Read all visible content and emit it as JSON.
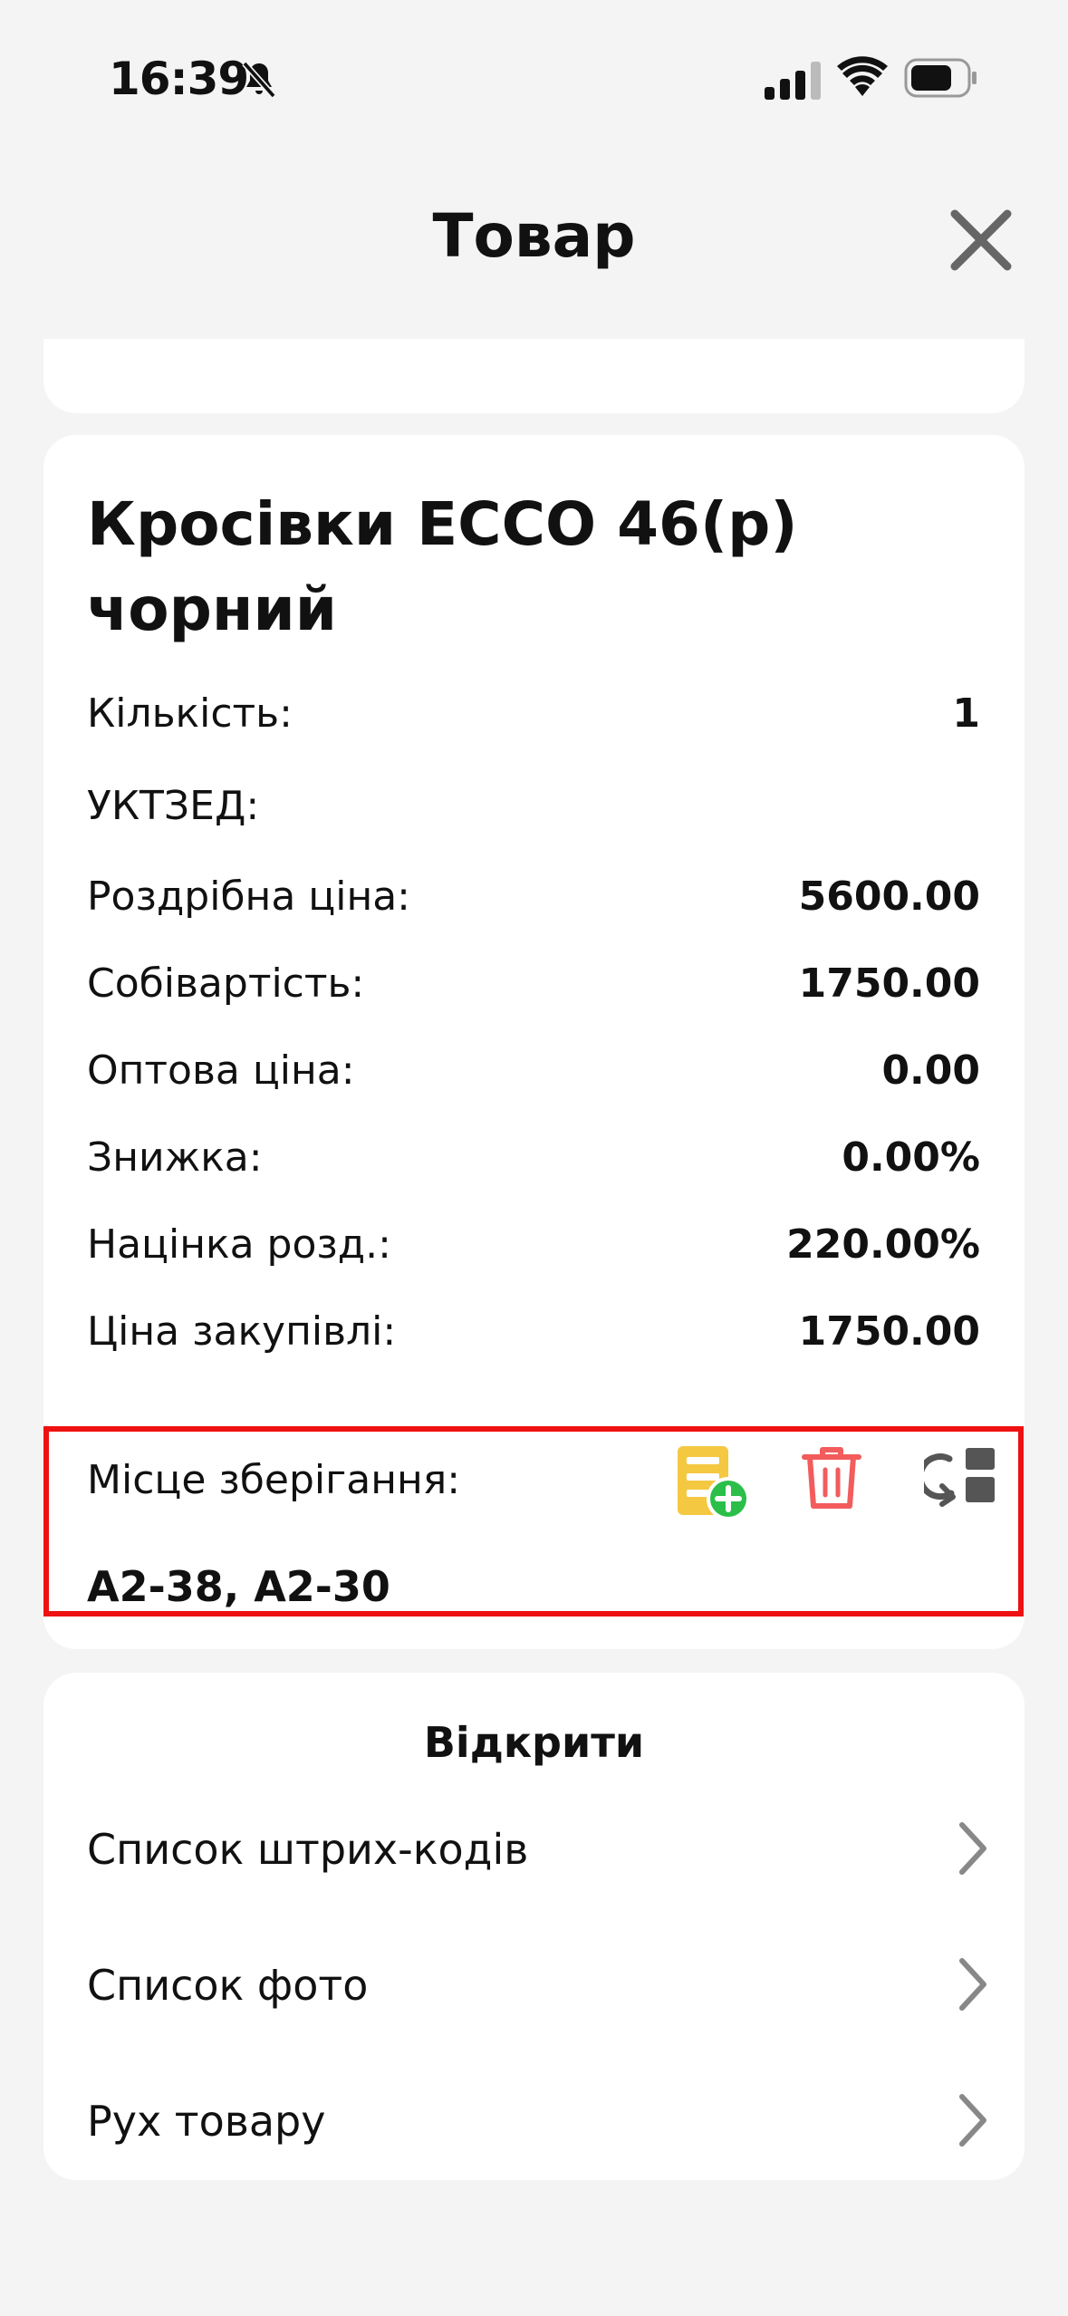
{
  "status_bar": {
    "time": "16:39"
  },
  "nav": {
    "title": "Товар"
  },
  "product": {
    "title": "Кросівки ECCO 46(р) чорний",
    "fields": [
      {
        "label": "Кількість:",
        "value": "1"
      },
      {
        "label": "УКТЗЕД:",
        "value": ""
      },
      {
        "label": "Роздрібна ціна:",
        "value": "5600.00"
      },
      {
        "label": "Собівартість:",
        "value": "1750.00"
      },
      {
        "label": "Оптова ціна:",
        "value": "0.00"
      },
      {
        "label": "Знижка:",
        "value": "0.00%"
      },
      {
        "label": "Націнка розд.:",
        "value": "220.00%"
      },
      {
        "label": "Ціна закупівлі:",
        "value": "1750.00"
      }
    ]
  },
  "storage": {
    "label": "Місце зберігання:",
    "value": "A2-38, A2-30",
    "icons": [
      "storage-add-icon",
      "trash-icon",
      "move-storage-icon"
    ]
  },
  "open_section": {
    "title": "Відкрити",
    "items": [
      {
        "label": "Список штрих-кодів"
      },
      {
        "label": "Список фото"
      },
      {
        "label": "Рух товару"
      }
    ]
  },
  "colors": {
    "highlight_border": "#ee1111",
    "add_icon_yellow": "#f5c842",
    "add_icon_green": "#2bbf4a",
    "trash_red": "#f25c5c",
    "move_icon_gray": "#555555"
  }
}
